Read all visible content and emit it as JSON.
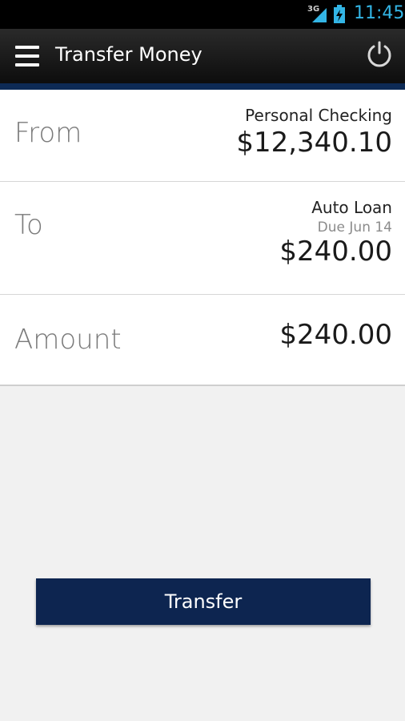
{
  "statusbar": {
    "network": "3G",
    "time": "11:45",
    "accent_color": "#33b5e5"
  },
  "appbar": {
    "title": "Transfer Money",
    "menu_icon": "hamburger-menu-icon",
    "power_icon": "power-icon"
  },
  "form": {
    "from": {
      "label": "From",
      "account": "Personal Checking",
      "balance": "$12,340.10"
    },
    "to": {
      "label": "To",
      "account": "Auto Loan",
      "due": "Due Jun 14",
      "amount": "$240.00"
    },
    "amount": {
      "label": "Amount",
      "value": "$240.00"
    }
  },
  "actions": {
    "transfer_label": "Transfer",
    "button_color": "#0d2550"
  }
}
